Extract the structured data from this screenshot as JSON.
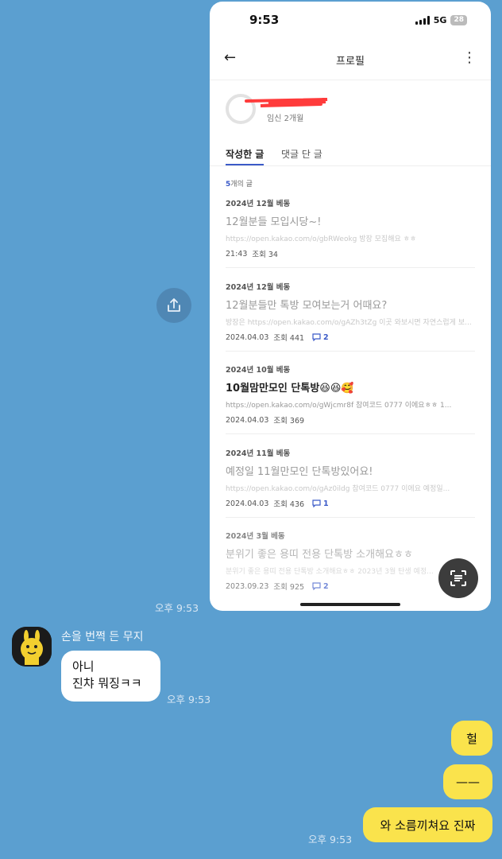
{
  "phone": {
    "status_time": "9:53",
    "network": "5G",
    "battery": "28",
    "page_title": "프로필",
    "profile_subinfo": "임신 2개월",
    "tabs": {
      "written": "작성한 글",
      "commented": "댓글 단 글"
    },
    "post_count_num": "5",
    "post_count_rest": "개의 글",
    "posts": [
      {
        "category": "2024년 12월 베동",
        "title": "12월분들 모입시당~!",
        "body": "https://open.kakao.com/o/gbRWeokg 방장 모집해요 ㅎㅎ",
        "date": "21:43",
        "views": "조회 34",
        "comments": ""
      },
      {
        "category": "2024년 12월 베동",
        "title": "12월분들만 톡방 모여보는거 어때요?",
        "body": "방장은 https://open.kakao.com/o/gAZh3tZg 이곳 와보시면 자연스럽게 보...",
        "date": "2024.04.03",
        "views": "조회 441",
        "comments": "2"
      },
      {
        "category": "2024년 10월 베동",
        "title": "10월맘만모인 단톡방😆😆🥰",
        "body": "https://open.kakao.com/o/gWjcmr8f 참여코드 0777 이에요ㅎㅎ 1...",
        "date": "2024.04.03",
        "views": "조회 369",
        "comments": ""
      },
      {
        "category": "2024년 11월 베동",
        "title": "예정일 11월만모인 단톡방있어요!",
        "body": "https://open.kakao.com/o/gAz0ildg 참여코드 0777 이에요 예정일...",
        "date": "2024.04.03",
        "views": "조회 436",
        "comments": "1"
      },
      {
        "category": "2024년 3월 베동",
        "title": "분위기 좋은 용띠 전용 단톡방 소개해요ㅎㅎ",
        "body": "분위기 좋은 용띠 전용 단톡방 소개해요ㅎㅎ 2023년 3월 탄생 예정...",
        "date": "2023.09.23",
        "views": "조회 925",
        "comments": "2"
      }
    ]
  },
  "chat": {
    "time_after_image": "오후 9:53",
    "sender_name": "손을 번쩍 든 무지",
    "incoming": {
      "line1": "아니",
      "line2": "진챠 뭐징ㅋㅋ",
      "time": "오후 9:53"
    },
    "outgoing": [
      "헐",
      "——",
      "와 소름끼쳐요 진짜"
    ],
    "outgoing_time": "오후 9:53"
  },
  "colors": {
    "chat_bg": "#5b9fd0",
    "my_bubble": "#fae34c",
    "accent": "#3b5ac8"
  },
  "icons": [
    "back-arrow-icon",
    "more-vertical-icon",
    "share-icon",
    "text-scan-icon",
    "comment-icon",
    "signal-icon",
    "battery-icon"
  ]
}
